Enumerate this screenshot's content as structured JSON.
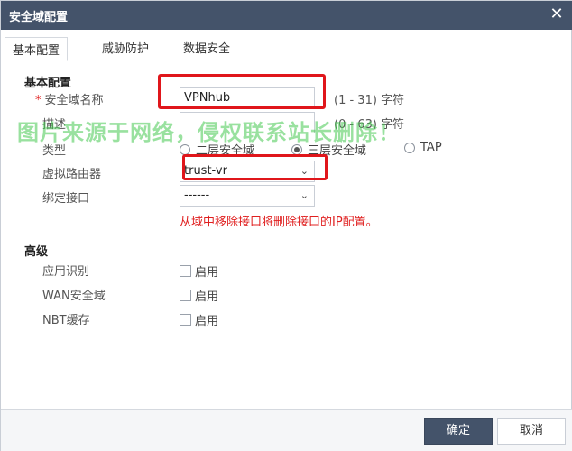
{
  "dialog": {
    "title": "安全域配置",
    "close_icon": "close-icon"
  },
  "tabs": [
    {
      "label": "基本配置",
      "active": true
    },
    {
      "label": "威胁防护",
      "active": false
    },
    {
      "label": "数据安全",
      "active": false
    }
  ],
  "basic": {
    "section_title": "基本配置",
    "name_label": "安全域名称",
    "required_mark": "*",
    "name_value": "VPNhub",
    "name_hint": "(1 - 31) 字符",
    "desc_label": "描述",
    "desc_value": "",
    "desc_hint": "(0 - 63) 字符",
    "type_label": "类型",
    "type_options": [
      "二层安全域",
      "三层安全域",
      "TAP"
    ],
    "type_selected": "三层安全域",
    "vrouter_label": "虚拟路由器",
    "vrouter_value": "trust-vr",
    "bind_label": "绑定接口",
    "bind_value": "------",
    "warning": "从域中移除接口将删除接口的IP配置。"
  },
  "advanced": {
    "section_title": "高级",
    "app_label": "应用识别",
    "wan_label": "WAN安全域",
    "nbt_label": "NBT缓存",
    "enable_label": "启用"
  },
  "watermark": "图片来源于网络，侵权联系站长删除！",
  "footer": {
    "ok_label": "确定",
    "cancel_label": "取消"
  },
  "colors": {
    "titlebar": "#44536a",
    "warning": "#e02020",
    "highlight": "#e0161b",
    "watermark": "#46c850"
  }
}
